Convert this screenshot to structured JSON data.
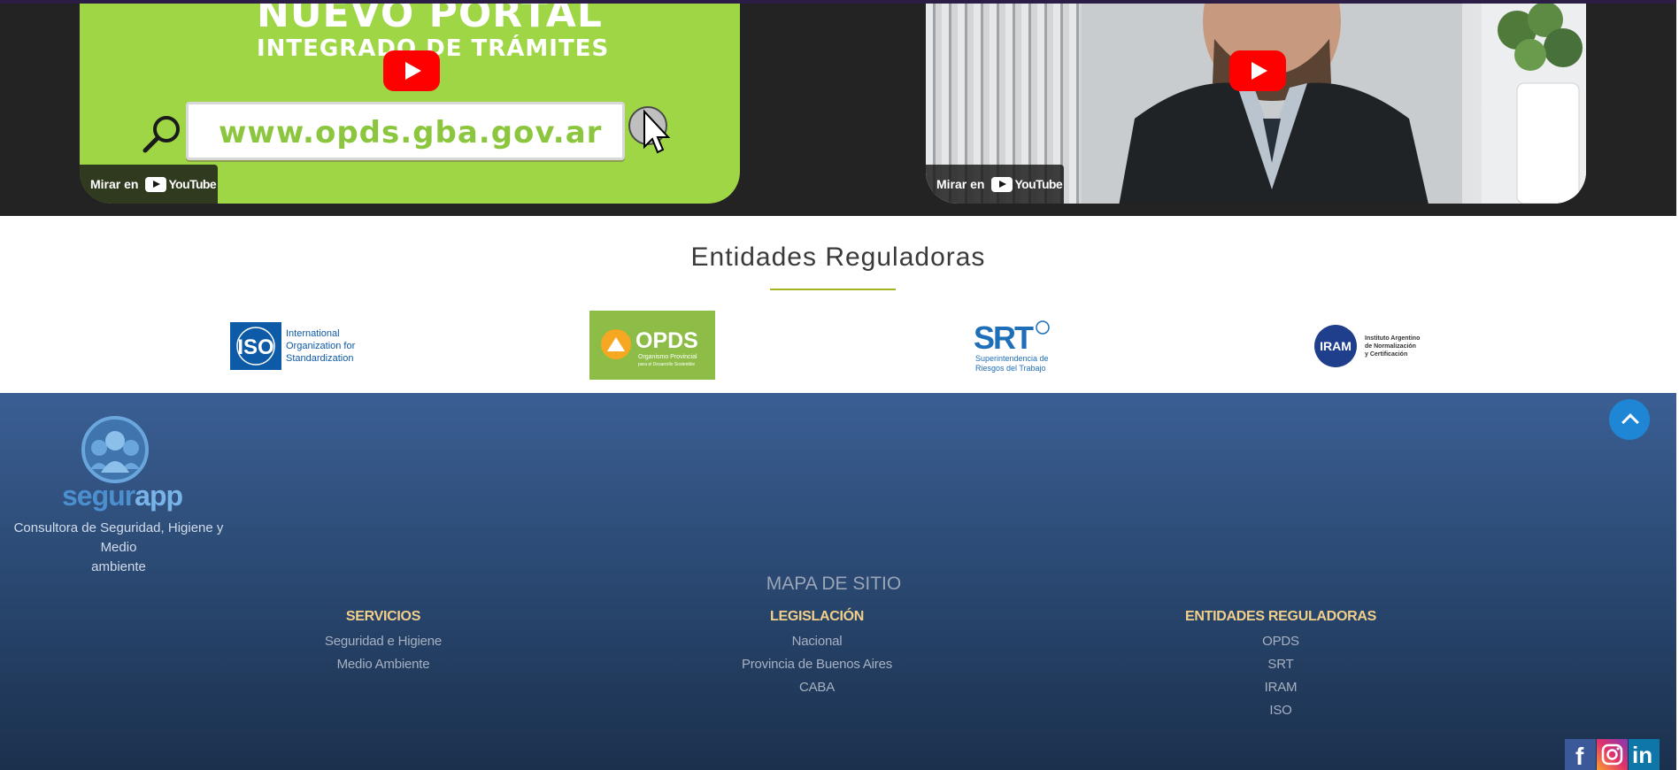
{
  "videos": [
    {
      "title_line1": "NUEVO PORTAL",
      "title_line2": "INTEGRADO DE TRÁMITES",
      "url": "www.opds.gba.gov.ar",
      "watch_label": "Mirar en",
      "platform": "YouTube"
    },
    {
      "watch_label": "Mirar en",
      "platform": "YouTube"
    }
  ],
  "entities": {
    "title": "Entidades Reguladoras",
    "logos": [
      {
        "name": "ISO",
        "text": [
          "International",
          "Organization for",
          "Standardization"
        ],
        "color": "#0d5aa7"
      },
      {
        "name": "OPDS",
        "text": [
          "Organismo Provincial",
          "para el Desarrollo Sostenible"
        ],
        "color": "#8dbd47"
      },
      {
        "name": "SRT",
        "text": [
          "Superintendencia de",
          "Riesgos del Trabajo"
        ],
        "color": "#1e6fb8"
      },
      {
        "name": "IRAM",
        "text": [
          "Instituto Argentino",
          "de Normalización",
          "y Certificación"
        ],
        "color": "#1f3e8c"
      }
    ]
  },
  "footer": {
    "brand_part1": "segur",
    "brand_part2": "app",
    "tagline_line1": "Consultora de Seguridad, Higiene y Medio",
    "tagline_line2": "ambiente",
    "sitemap_title": "MAPA DE SITIO",
    "columns": [
      {
        "heading": "SERVICIOS",
        "links": [
          "Seguridad e Higiene",
          "Medio Ambiente"
        ]
      },
      {
        "heading": "LEGISLACIÓN",
        "links": [
          "Nacional",
          "Provincia de Buenos Aires",
          "CABA"
        ]
      },
      {
        "heading": "ENTIDADES REGULADORAS",
        "links": [
          "OPDS",
          "SRT",
          "IRAM",
          "ISO"
        ]
      }
    ],
    "social": [
      "facebook-icon",
      "instagram-icon",
      "linkedin-icon"
    ]
  },
  "colors": {
    "accent_line": "#a5b322",
    "footer_heading": "#f2cf8a",
    "scroll_top": "#1f86d6"
  }
}
